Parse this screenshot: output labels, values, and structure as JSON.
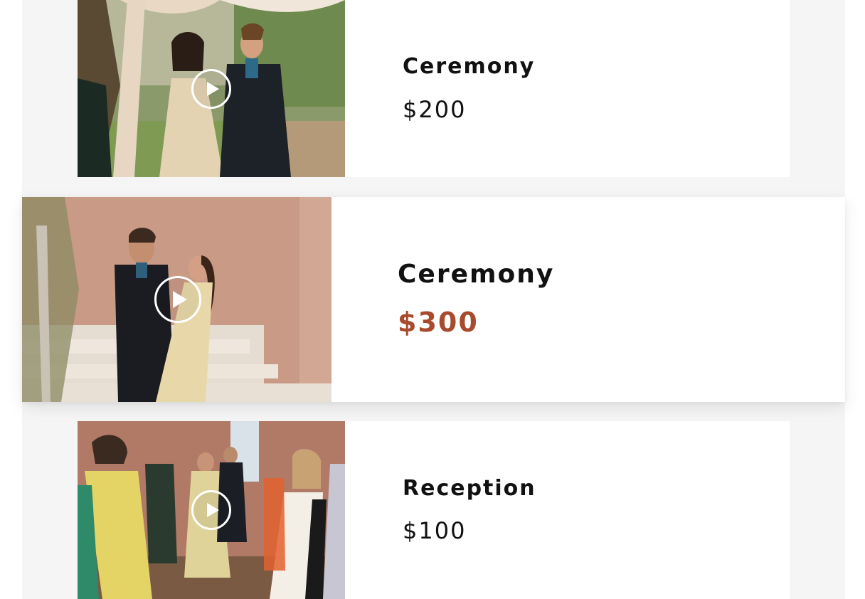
{
  "colors": {
    "background": "#f5f5f5",
    "card": "#ffffff",
    "text": "#111111",
    "accent_price": "#a84a2c"
  },
  "items": [
    {
      "title": "Ceremony",
      "price": "$200",
      "icon": "play-icon"
    },
    {
      "title": "Ceremony",
      "price": "$300",
      "icon": "play-icon"
    },
    {
      "title": "Reception",
      "price": "$100",
      "icon": "play-icon"
    }
  ]
}
